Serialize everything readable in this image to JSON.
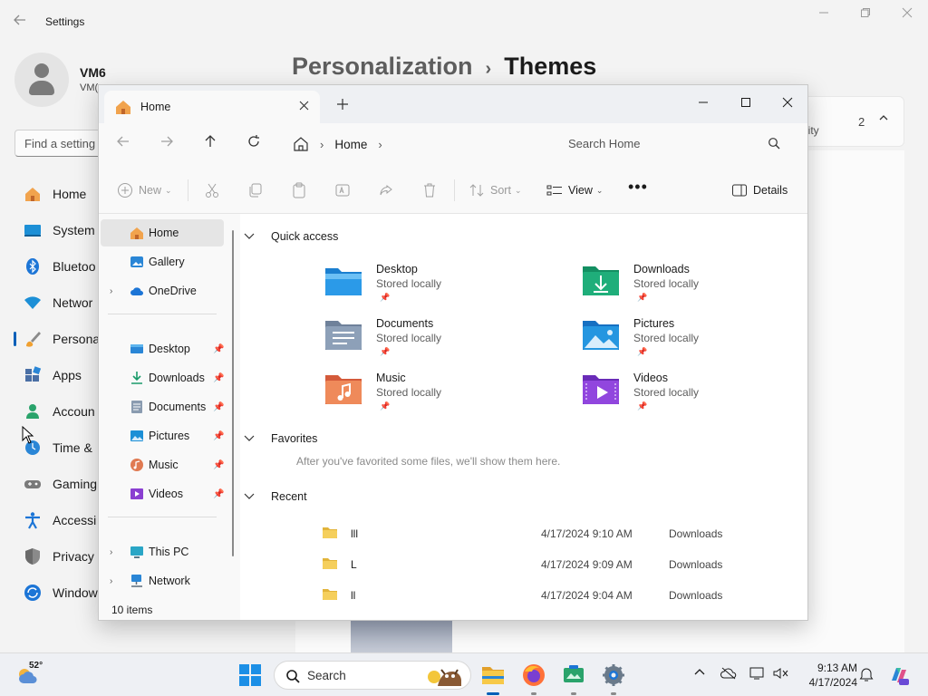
{
  "settings": {
    "title": "Settings",
    "user_name": "VM6",
    "user_sub": "VM(",
    "find_placeholder": "Find a setting",
    "nav": [
      "Home",
      "System",
      "Bluetoo",
      "Networ",
      "Persona",
      "Apps",
      "Accoun",
      "Time &",
      "Gaming",
      "Accessi",
      "Privacy",
      "Window"
    ],
    "breadcrumb_parent": "Personalization",
    "breadcrumb_sep": "›",
    "breadcrumb_current": "Themes",
    "card_text": "lity",
    "card_count": "2"
  },
  "explorer": {
    "tab_label": "Home",
    "address_crumb": "Home",
    "search_placeholder": "Search Home",
    "commands": {
      "new": "New",
      "sort": "Sort",
      "view": "View",
      "details": "Details"
    },
    "sidebar": {
      "top": [
        "Home",
        "Gallery",
        "OneDrive"
      ],
      "pinned": [
        "Desktop",
        "Downloads",
        "Documents",
        "Pictures",
        "Music",
        "Videos"
      ],
      "bottom": [
        "This PC",
        "Network"
      ]
    },
    "status": "10 items",
    "sections": {
      "quick_access": "Quick access",
      "favorites": "Favorites",
      "favorites_msg": "After you've favorited some files, we'll show them here.",
      "recent": "Recent"
    },
    "quick_access": [
      {
        "name": "Desktop",
        "status": "Stored locally"
      },
      {
        "name": "Downloads",
        "status": "Stored locally"
      },
      {
        "name": "Documents",
        "status": "Stored locally"
      },
      {
        "name": "Pictures",
        "status": "Stored locally"
      },
      {
        "name": "Music",
        "status": "Stored locally"
      },
      {
        "name": "Videos",
        "status": "Stored locally"
      }
    ],
    "recent": [
      {
        "name": "lll",
        "date": "4/17/2024 9:10 AM",
        "location": "Downloads"
      },
      {
        "name": "L",
        "date": "4/17/2024 9:09 AM",
        "location": "Downloads"
      },
      {
        "name": "ll",
        "date": "4/17/2024 9:04 AM",
        "location": "Downloads"
      }
    ]
  },
  "taskbar": {
    "temperature": "52°",
    "search_label": "Search",
    "time": "9:13 AM",
    "date": "4/17/2024"
  }
}
